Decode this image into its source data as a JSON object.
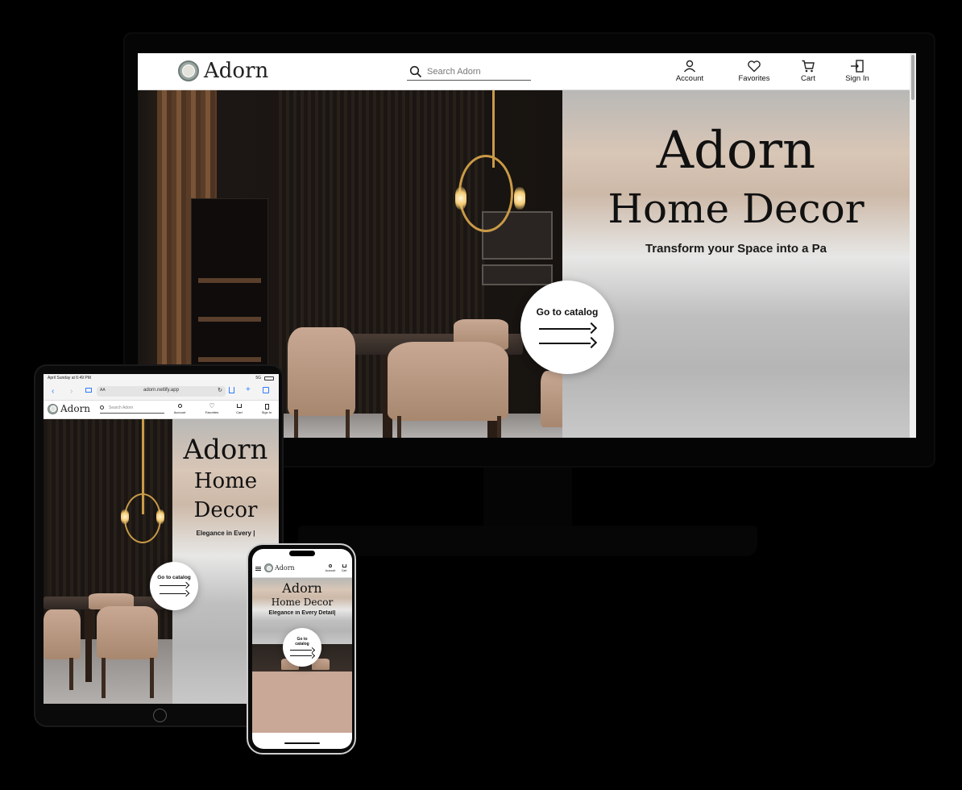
{
  "brand": {
    "name": "Adorn"
  },
  "desktop": {
    "search_placeholder": "Search Adorn",
    "nav": [
      {
        "label": "Account",
        "icon": "user-icon"
      },
      {
        "label": "Favorites",
        "icon": "heart-icon"
      },
      {
        "label": "Cart",
        "icon": "cart-icon"
      },
      {
        "label": "Sign In",
        "icon": "sign-in-icon"
      }
    ],
    "hero": {
      "title": "Adorn",
      "subtitle": "Home Decor",
      "tagline": "Transform your Space into a Pa",
      "cta": "Go to catalog"
    }
  },
  "tablet": {
    "status_time": "April Sunday at 6:49 PM",
    "status_signal": "5G",
    "url": "adorn.netlify.app",
    "text_size_label": "AA",
    "search_placeholder": "Search Adorn",
    "nav": [
      {
        "label": "Account",
        "icon": "user-icon"
      },
      {
        "label": "Favorites",
        "icon": "heart-icon"
      },
      {
        "label": "Cart",
        "icon": "cart-icon"
      },
      {
        "label": "Sign In",
        "icon": "sign-in-icon"
      }
    ],
    "hero": {
      "title": "Adorn",
      "subtitle_line1": "Home",
      "subtitle_line2": "Decor",
      "tagline": "Elegance in Every |",
      "cta": "Go to catalog"
    }
  },
  "phone": {
    "nav": [
      {
        "label": "Account",
        "icon": "user-icon"
      },
      {
        "label": "Cart",
        "icon": "cart-icon"
      }
    ],
    "hero": {
      "title": "Adorn",
      "subtitle": "Home Decor",
      "tagline": "Elegance in Every Detail|",
      "cta_line1": "Go to",
      "cta_line2": "catalog"
    }
  },
  "colors": {
    "gold": "#c99a47",
    "chair": "#c8a893",
    "phone_block": "#c9a897",
    "frost": "#d8c6b6"
  }
}
